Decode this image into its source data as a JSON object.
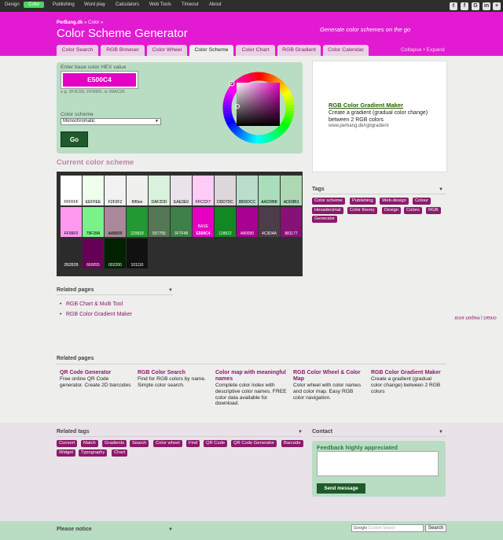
{
  "topnav": {
    "items": [
      "Design",
      "Color",
      "Publishing",
      "Word play",
      "Calculators",
      "Web Tools",
      "Timeout",
      "About"
    ],
    "social_icons": [
      "twitter-icon",
      "facebook-icon",
      "google-icon",
      "linkedin-icon",
      "plus-icon"
    ]
  },
  "header": {
    "breadcrumb_site": "PerBang.dk",
    "breadcrumb_sep": " » Color »",
    "title": "Color Scheme Generator",
    "tagline": "Generate color schemes on the go",
    "tabs": [
      "Color Search",
      "RGB Browser",
      "Color Wheel",
      "Color Scheme",
      "Color Chart",
      "RGB Gradient",
      "Color Calendar"
    ],
    "collapse": "Collapse",
    "expand": "Expand",
    "bullet": "•"
  },
  "form": {
    "hex_label": "Enter base color HEX value",
    "hex_value": "E500C4",
    "hex_hint": "e.g. 2F3C56, FF9900, or 99AC06",
    "scheme_label": "Color scheme",
    "scheme_value": "Monochromatic",
    "go_label": "Go"
  },
  "scheme": {
    "heading": "Current color scheme",
    "swatches": [
      {
        "hex": "FFFFFF",
        "color": "#ffffff",
        "text": "#000000"
      },
      {
        "hex": "EEFFEE",
        "color": "#eeffee",
        "text": "#000000"
      },
      {
        "hex": "F2F2F2",
        "color": "#f2f2f2",
        "text": "#000000"
      },
      {
        "hex": "f0f0ee",
        "color": "#f0f0ee",
        "text": "#000000"
      },
      {
        "hex": "DAF2DD",
        "color": "#daf2dd",
        "text": "#000000"
      },
      {
        "hex": "EAE3E9",
        "color": "#eae3e9",
        "text": "#000000"
      },
      {
        "hex": "FFCCF7",
        "color": "#ffccf7",
        "text": "#000000"
      },
      {
        "hex": "DDD7DC",
        "color": "#ddd7dc",
        "text": "#000000"
      },
      {
        "hex": "BBDDCC",
        "color": "#bbddcc",
        "text": "#000000"
      },
      {
        "hex": "AADDBB",
        "color": "#aaddbb",
        "text": "#000000"
      },
      {
        "hex": "ADD8B3",
        "color": "#add8b3",
        "text": "#000000"
      },
      {
        "hex": "FF99F0",
        "color": "#ff99f0",
        "text": "#000000"
      },
      {
        "hex": "79F28A",
        "color": "#79f28a",
        "text": "#000000"
      },
      {
        "hex": "AA8899",
        "color": "#aa8899",
        "text": "#000000"
      },
      {
        "hex": "229933",
        "color": "#229933",
        "text": "#ffffff"
      },
      {
        "hex": "557755",
        "color": "#557755",
        "text": "#ffffff"
      },
      {
        "hex": "3F7F48",
        "color": "#3f7f48",
        "text": "#ffffff"
      },
      {
        "hex": "E500C4",
        "color": "#e500c4",
        "text": "#ffffff",
        "base": "BASE"
      },
      {
        "hex": "118822",
        "color": "#118822",
        "text": "#ffffff"
      },
      {
        "hex": "A80090",
        "color": "#a80090",
        "text": "#ffffff"
      },
      {
        "hex": "4C3D4A",
        "color": "#4c3d4a",
        "text": "#ffffff"
      },
      {
        "hex": "881177",
        "color": "#881177",
        "text": "#ffffff"
      },
      {
        "hex": "2B2B2B",
        "color": "#2b2b2b",
        "text": "#ffffff"
      },
      {
        "hex": "660055",
        "color": "#660055",
        "text": "#ffffff"
      },
      {
        "hex": "002200",
        "color": "#002200",
        "text": "#ffffff"
      },
      {
        "hex": "101110",
        "color": "#101110",
        "text": "#ffffff"
      }
    ]
  },
  "ad": {
    "title": "RGB Color Gradient Maker",
    "text": "Create a gradient (gradual color change) between 2 RGB colors",
    "url": "www.perbang.dk/rgbgradient"
  },
  "tags": {
    "heading": "Tags",
    "items": [
      "Color scheme",
      "Publishing",
      "Web-design",
      "Colour",
      "Hexadecimal",
      "Color theory",
      "Design",
      "Colors",
      "RGB",
      "Generator"
    ]
  },
  "related_small": {
    "heading": "Related pages",
    "links": [
      "RGB Chart & Multi Tool",
      "RGB Color Gradient Maker"
    ]
  },
  "side_link": "ontact | Report error",
  "related_pages": {
    "heading": "Related pages",
    "items": [
      {
        "title": "QR Code Generator",
        "desc": "Free online QR Code generator. Create 2D barcodes"
      },
      {
        "title": "RGB Color Search",
        "desc": "Find for RGB colors by name. Simple color search."
      },
      {
        "title": "Color map with meaningful names",
        "desc": "Complete color index with descriptive color names. FREE color data available for download."
      },
      {
        "title": "RGB Color Wheel & Color Map",
        "desc": "Color wheel with color names and color map. Easy RGB color navigation."
      },
      {
        "title": "RGB Color Gradient Maker",
        "desc": "Create a gradient (gradual color change) between 2 RGB colors"
      }
    ]
  },
  "related_tags": {
    "heading": "Related tags",
    "items": [
      "Convert",
      "Match",
      "Gradients",
      "Search",
      "Color wheel",
      "Find",
      "QR Code",
      "QR Code Generator",
      "Barcode",
      "Widget",
      "Typography",
      "Chart"
    ]
  },
  "contact": {
    "heading": "Contact",
    "feedback_title": "Feedback highly appreciated",
    "send_label": "Send message"
  },
  "footer": {
    "notice_heading": "Please notice",
    "search_placeholder": "Custom Search",
    "search_brand": "Google",
    "search_button": "Search"
  },
  "colors": {
    "accent": "#e21bd2",
    "link": "#8b1a6b",
    "panel_green": "#b8ddc3",
    "topnav_active": "#4dd35f"
  }
}
